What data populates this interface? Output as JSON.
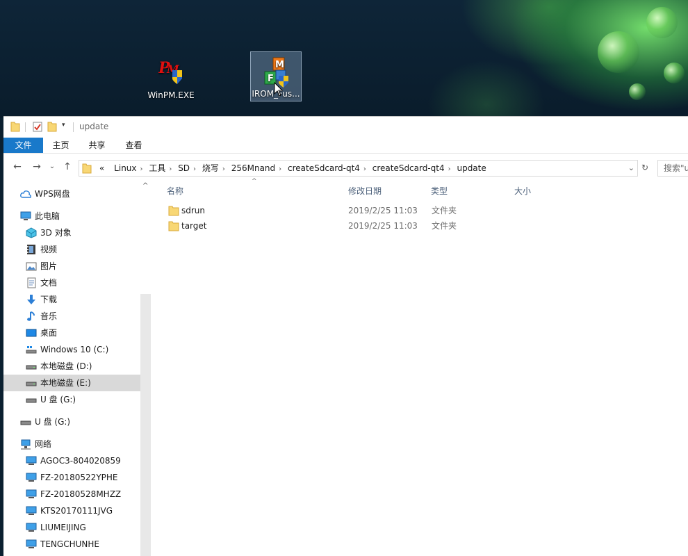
{
  "desktop": {
    "icons": [
      {
        "label": "WinPM.EXE",
        "icon": "winpm-app-icon"
      },
      {
        "label": "IROM_Fus...",
        "icon": "irom-fusing-app-icon"
      }
    ]
  },
  "window": {
    "title": "update",
    "ribbon_tabs": [
      "文件",
      "主页",
      "共享",
      "查看"
    ],
    "nav_buttons": {
      "back": "←",
      "forward": "→",
      "recent": "⌄",
      "up": "↑"
    },
    "address": {
      "prefix": "«",
      "crumbs": [
        "Linux",
        "工具",
        "SD",
        "烧写",
        "256Mnand",
        "createSdcard-qt4",
        "createSdcard-qt4",
        "update"
      ],
      "dropdown": "⌄",
      "refresh": "↻"
    },
    "search_placeholder": "搜索\"u"
  },
  "nav_pane": {
    "items": [
      {
        "label": "WPS网盘",
        "icon": "cloud-icon",
        "level": 0
      },
      {
        "label": "此电脑",
        "icon": "computer-icon",
        "level": 0
      },
      {
        "label": "3D 对象",
        "icon": "3d-objects-icon",
        "level": 1
      },
      {
        "label": "视频",
        "icon": "video-icon",
        "level": 1
      },
      {
        "label": "图片",
        "icon": "pictures-icon",
        "level": 1
      },
      {
        "label": "文档",
        "icon": "documents-icon",
        "level": 1
      },
      {
        "label": "下载",
        "icon": "download-icon",
        "level": 1
      },
      {
        "label": "音乐",
        "icon": "music-icon",
        "level": 1
      },
      {
        "label": "桌面",
        "icon": "desktop-icon",
        "level": 1
      },
      {
        "label": "Windows 10 (C:)",
        "icon": "system-drive-icon",
        "level": 1
      },
      {
        "label": "本地磁盘 (D:)",
        "icon": "drive-icon",
        "level": 1
      },
      {
        "label": "本地磁盘 (E:)",
        "icon": "drive-icon",
        "level": 1,
        "selected": true
      },
      {
        "label": "U 盘 (G:)",
        "icon": "usb-drive-icon",
        "level": 1
      },
      {
        "label": "U 盘 (G:)",
        "icon": "usb-drive-icon",
        "level": 0
      },
      {
        "label": "网络",
        "icon": "network-icon",
        "level": 0
      },
      {
        "label": "AGOC3-804020859",
        "icon": "network-computer-icon",
        "level": 1
      },
      {
        "label": "FZ-20180522YPHE",
        "icon": "network-computer-icon",
        "level": 1
      },
      {
        "label": "FZ-20180528MHZZ",
        "icon": "network-computer-icon",
        "level": 1
      },
      {
        "label": "KTS20170111JVG",
        "icon": "network-computer-icon",
        "level": 1
      },
      {
        "label": "LIUMEIJING",
        "icon": "network-computer-icon",
        "level": 1
      },
      {
        "label": "TENGCHUNHE",
        "icon": "network-computer-icon",
        "level": 1
      }
    ]
  },
  "content": {
    "columns": {
      "name": "名称",
      "date": "修改日期",
      "type": "类型",
      "size": "大小"
    },
    "files": [
      {
        "name": "sdrun",
        "date": "2019/2/25 11:03",
        "type": "文件夹",
        "size": ""
      },
      {
        "name": "target",
        "date": "2019/2/25 11:03",
        "type": "文件夹",
        "size": ""
      }
    ]
  },
  "colors": {
    "accent": "#1979ca",
    "folder": "#f8d775",
    "selection": "#d9d9d9"
  }
}
